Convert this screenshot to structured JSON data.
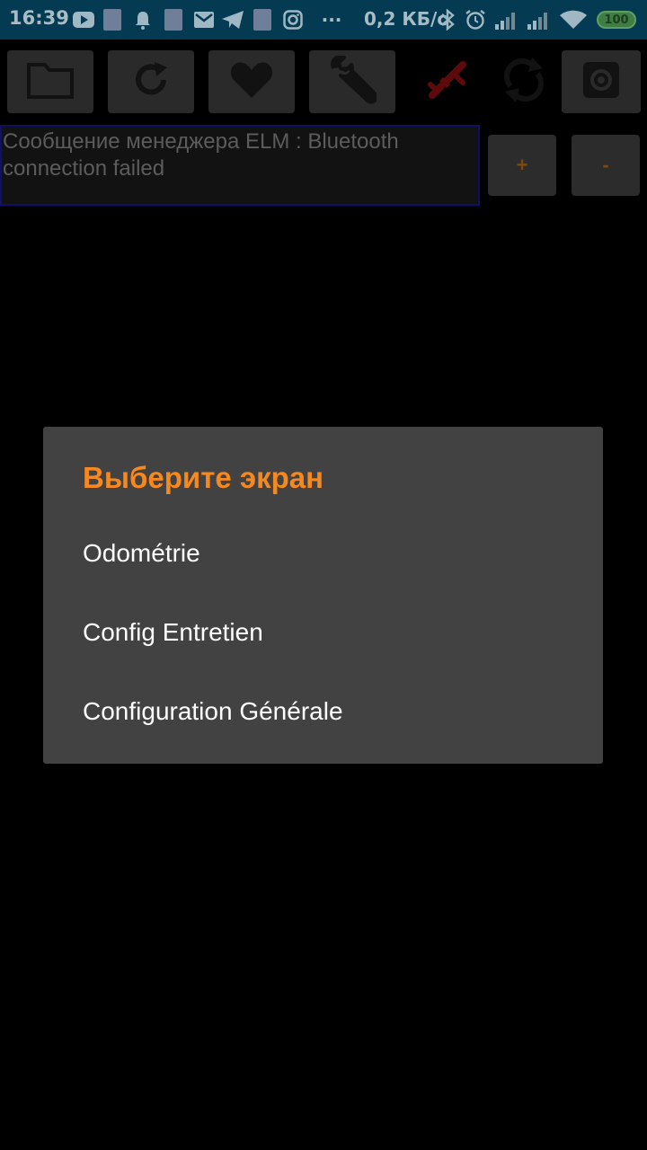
{
  "status_bar": {
    "time": "16:39",
    "network_speed": "0,2 КБ/с",
    "more": "···",
    "battery": "100",
    "icons": [
      "youtube-icon",
      "app-badge-icon",
      "bell-icon",
      "app-badge-icon",
      "gmail-icon",
      "telegram-icon",
      "app-badge-icon",
      "instagram-icon",
      "bluetooth-icon",
      "alarm-icon",
      "signal-icon",
      "signal-icon",
      "wifi-icon",
      "battery-icon"
    ]
  },
  "toolbar": {
    "buttons": [
      "folder-icon",
      "refresh-icon",
      "heart-icon",
      "wrench-icon",
      "connection-error-icon",
      "sync-icon",
      "settings-icon"
    ]
  },
  "message": {
    "text": "Сообщение менеджера ELM : Bluetooth connection failed"
  },
  "zoom": {
    "plus_label": "+",
    "minus_label": "-"
  },
  "dialog": {
    "title": "Выберите экран",
    "items": [
      "Odométrie",
      "Config Entretien",
      "Configuration Générale"
    ]
  },
  "colors": {
    "status_bar": "#053b52",
    "accent": "#f5891f",
    "dialog_bg": "#424242",
    "error_icon": "#c01515"
  }
}
